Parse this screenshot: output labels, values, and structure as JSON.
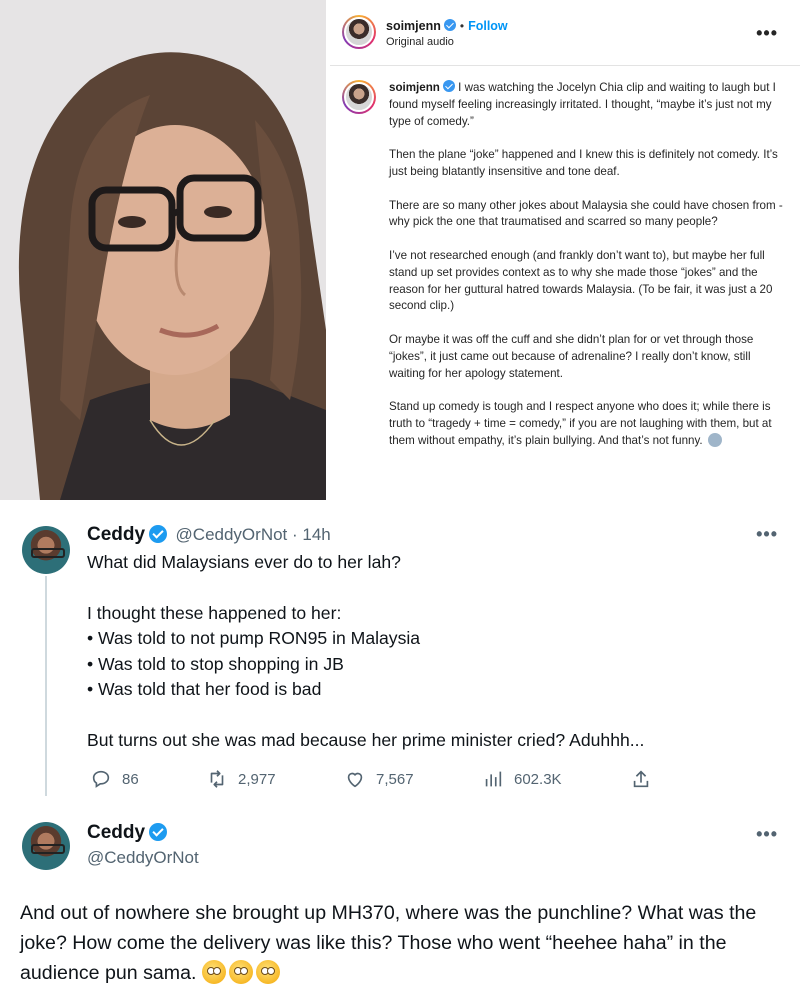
{
  "instagram": {
    "username": "soimjenn",
    "follow_label": "Follow",
    "separator": "•",
    "audio_label": "Original audio",
    "more_label": "•••",
    "caption": [
      "I was watching the Jocelyn Chia clip and waiting to laugh but I found myself feeling increasingly irritated. I thought, “maybe it’s just not my type of comedy.”",
      "Then the plane “joke” happened and I knew this is definitely not comedy. It’s just being blatantly insensitive and tone deaf.",
      "There are so many other jokes about Malaysia she could have chosen from - why pick the one that traumatised and scarred so many people?",
      "I’ve not researched enough (and frankly don’t want to), but maybe her full stand up set provides context as to why she made those “jokes” and the reason for her guttural hatred towards Malaysia. (To be fair, it was just a 20 second clip.)",
      "Or maybe it was off the cuff and she didn’t plan for or vet through those “jokes”, it just came out because of adrenaline? I really don’t know, still waiting for her apology statement.",
      "Stand up comedy is tough and I respect anyone who does it; while there is truth to “tragedy + time = comedy,” if you are not laughing with them, but at them without empathy, it’s plain bullying. And that’s not funny."
    ],
    "caption_emoji": "crying-face"
  },
  "tweet1": {
    "name": "Ceddy",
    "handle": "@CeddyOrNot · 14h",
    "more_label": "•••",
    "line1": "What did Malaysians ever do to her lah?",
    "line2": "I thought these happened to her:",
    "bullets": [
      "• Was told to not pump RON95 in Malaysia",
      "• Was told to stop shopping in JB",
      "• Was told that her food is bad"
    ],
    "line3": "But turns out she was mad because her prime minister cried? Aduhhh...",
    "stats": {
      "replies": "86",
      "retweets": "2,977",
      "likes": "7,567",
      "views": "602.3K"
    }
  },
  "tweet2": {
    "name": "Ceddy",
    "handle": "@CeddyOrNot",
    "more_label": "•••",
    "text": "And out of nowhere she brought up MH370, where was the punchline? What was the joke? How come the delivery was like this? Those who went “heehee haha” in the audience pun sama.",
    "emoji": "face-with-rolling-eyes ×3"
  },
  "colors": {
    "ig_link": "#0095f6",
    "tw_verified": "#1d9bf0",
    "muted": "#536471",
    "text": "#0f1419"
  }
}
